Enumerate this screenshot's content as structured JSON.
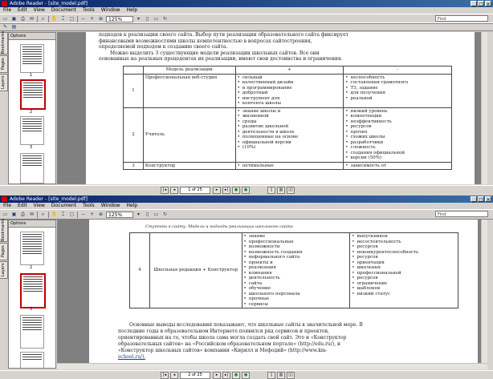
{
  "windows": [
    {
      "title": "Adobe Reader - [site_model.pdf]",
      "menu": [
        "File",
        "Edit",
        "View",
        "Document",
        "Tools",
        "Window",
        "Help"
      ],
      "zoom": "125%",
      "search_placeholder": "Find",
      "page_label": "1 of 25",
      "sidebar_tabs": [
        "Bookmarks",
        "Pages",
        "Layers"
      ],
      "thumbs_header": "Options",
      "thumb_numbers": [
        "1",
        "2",
        "3"
      ],
      "text_top": [
        "подходов к реализации своего сайта. Выбор пути реализации образовательного сайта фиксирует",
        "финансовыми возможностями школы компетентностью в вопросах сайтостроения,",
        "определяемой подходом к созданию своего сайта.",
        "Можно выделить 3 существующие модели реализации школьных сайтов. Все они",
        "основанные на реальных прецедентах их реализации, имеют свои достоинства и ограничения."
      ],
      "table": {
        "header": [
          "",
          "Модель реализации",
          "+",
          "-"
        ],
        "rows": [
          {
            "num": "1",
            "model": "Профессиональная веб-студия",
            "plus": [
              "сильный",
              "качественный дизайн",
              "и программирование",
              "добротный",
              "инструмент для",
              "контента школы"
            ],
            "minus": [
              "неспособность",
              "составления грамотного",
              "ТЗ, задание",
              "для получения",
              "реальной"
            ]
          },
          {
            "num": "2",
            "model": "Учитель",
            "plus": [
              "знание школы и",
              "жизненной",
              "среды",
              "развитие школьной",
              "деятельности в школе",
              "полноценные на основе",
              "официальной версии",
              "(10%)"
            ],
            "minus": [
              "низкий уровень",
              "компетенции",
              "неэффективность",
              "ресурсов",
              "прочих",
              "схожих школы",
              "разработчики",
              "сложность",
              "создания официальной",
              "версии (50%)"
            ]
          },
          {
            "num": "3",
            "model": "Конструктор",
            "plus": [
              "оптимальные"
            ],
            "minus": [
              "зависимость от"
            ]
          }
        ]
      }
    },
    {
      "title": "Adobe Reader - [site_model.pdf]",
      "menu": [
        "File",
        "Edit",
        "View",
        "Document",
        "Tools",
        "Window",
        "Help"
      ],
      "zoom": "125%",
      "search_placeholder": "Find",
      "page_label": "2 of 25",
      "sidebar_tabs": [
        "Bookmarks",
        "Pages",
        "Layers"
      ],
      "thumbs_header": "Options",
      "thumb_numbers": [
        "2",
        "3"
      ],
      "header_line": "Ступенки к сайту. Модели и подходы реализации школьного сайта",
      "table": {
        "num": "4",
        "model": "Школьная редакция + Конструктор",
        "plus": [
          "знание",
          "профессиональные",
          "возможности",
          "возможность создания",
          "неформального сайта",
          "проекты и",
          "реализация",
          "компания",
          "деятельность",
          "сайта",
          "обучение",
          "школьного персонала",
          "прочные",
          "сервисы"
        ],
        "minus": [
          "выпускников",
          "несостоятельность",
          "ресурсов",
          "неконкурентоспособность",
          "ресурсов",
          "ориентация",
          "школьных",
          "профессиональной",
          "ресурсов",
          "ограничение",
          "шаблонов",
          "низкий статус"
        ]
      },
      "text_bottom": [
        "Основные выводы исследования показывают, что школьные сайты в значительной мере. В",
        "последние годы в образовательном Интернете появился ряд сервисов и проектов,",
        "ориентированных на то, чтобы школа сама могла создать свой сайт. Это и «Конструктор",
        "образовательных сайтов» на «Российском образовательном портале» (http://edu.ru/), и",
        "«Конструктор школьных сайтов» компании «Кирилл и Мефодий» (http://www.km-",
        "school.ru/)."
      ]
    }
  ],
  "colors": {
    "titlebar_start": "#0a246a",
    "titlebar_end": "#3a6ea5",
    "window_bg": "#d6d3ce",
    "doc_bg": "#808080",
    "thumb_selected": "#c00000"
  }
}
